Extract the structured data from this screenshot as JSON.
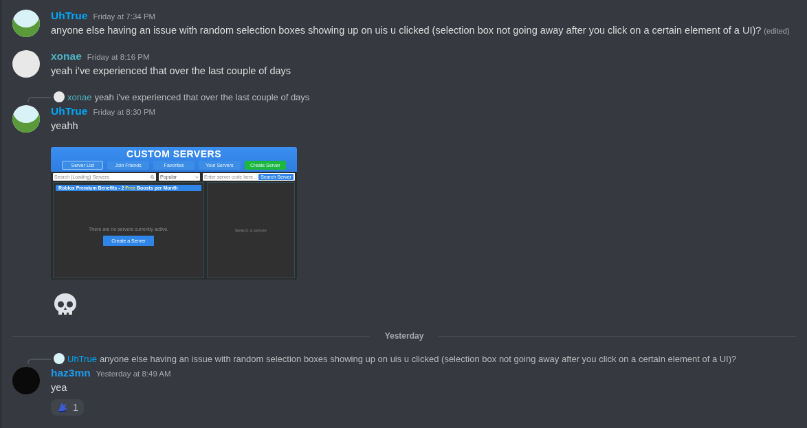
{
  "messages": [
    {
      "kind": "message",
      "avatar": {
        "kind": "frog"
      },
      "author": {
        "name": "UhTrue",
        "color": "#00a8fc"
      },
      "timestamp": "Friday at 7:34 PM",
      "text": "anyone else having an issue with random selection boxes showing up on uis u clicked (selection box not going away after you click on a certain element of a UI)?",
      "edited": "(edited)"
    },
    {
      "kind": "message",
      "avatar": {
        "kind": "light"
      },
      "author": {
        "name": "xonae",
        "color": "#4fb3c3"
      },
      "timestamp": "Friday at 8:16 PM",
      "text": "yeah i’ve experienced that over the last couple of days"
    },
    {
      "kind": "message",
      "avatar": {
        "kind": "frog"
      },
      "reply": {
        "avatar": {
          "kind": "light"
        },
        "author": "xonae",
        "color": "#4fb3c3",
        "text": "yeah i’ve experienced that over the last couple of days"
      },
      "author": {
        "name": "UhTrue",
        "color": "#00a8fc"
      },
      "timestamp": "Friday at 8:30 PM",
      "text": "yeahh",
      "attachment": {
        "title": "CUSTOM SERVERS",
        "tabs": [
          {
            "label": "Server List",
            "selected": true
          },
          {
            "label": "Join Friends",
            "selected": false
          },
          {
            "label": "Favorites",
            "selected": false
          },
          {
            "label": "Your Servers",
            "selected": false
          },
          {
            "label": "Create Server",
            "selected": false,
            "kind": "create"
          }
        ],
        "search": {
          "placeholder": "Search (Loading) Servers"
        },
        "sort": {
          "value": "Popular"
        },
        "code": {
          "placeholder": "Enter server code here..."
        },
        "code_button": "Search Server",
        "banner": {
          "before": "Roblox Premium Benefits - 2 ",
          "highlight": "Free",
          "after": " Boosts per Month"
        },
        "empty_text": "There are no servers currently active.",
        "create_button": "Create a Server",
        "detail_text": "Select a server"
      },
      "emoji": {
        "kind": "skull"
      }
    },
    {
      "kind": "divider",
      "label": "Yesterday"
    },
    {
      "kind": "message",
      "avatar": {
        "kind": "dark"
      },
      "reply": {
        "avatar": {
          "kind": "frog"
        },
        "author": "UhTrue",
        "color": "#00a8fc",
        "text": "anyone else having an issue with random selection boxes showing up on uis u clicked (selection box not going away after you click on a certain element of a UI)?"
      },
      "author": {
        "name": "haz3mn",
        "color": "#1e9bf0"
      },
      "timestamp": "Yesterday at 8:49 AM",
      "text": "yea",
      "reaction": {
        "count": "1"
      }
    }
  ]
}
